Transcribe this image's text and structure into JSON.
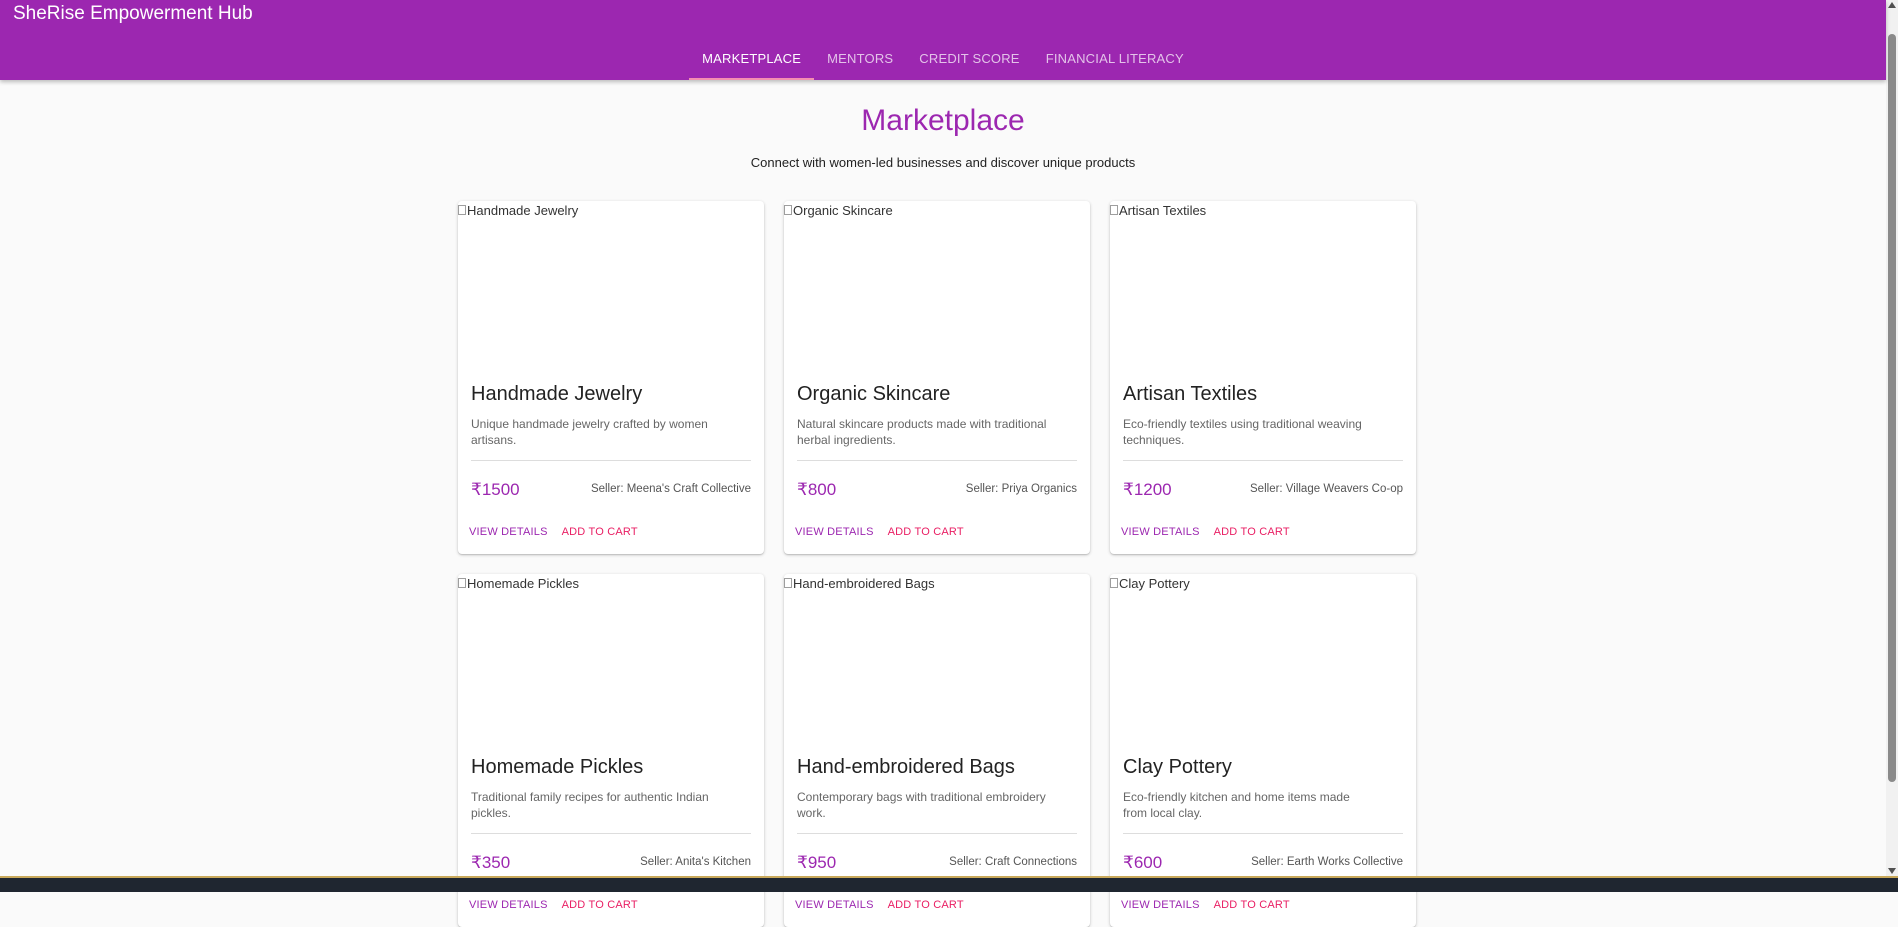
{
  "app": {
    "title": "SheRise Empowerment Hub"
  },
  "nav": {
    "tabs": [
      {
        "label": "MARKETPLACE",
        "active": true
      },
      {
        "label": "MENTORS",
        "active": false
      },
      {
        "label": "CREDIT SCORE",
        "active": false
      },
      {
        "label": "FINANCIAL LITERACY",
        "active": false
      }
    ]
  },
  "page": {
    "title": "Marketplace",
    "subtitle": "Connect with women-led businesses and discover unique products"
  },
  "products": [
    {
      "image_alt": "Handmade Jewelry",
      "name": "Handmade Jewelry",
      "description": "Unique handmade jewelry crafted by women artisans.",
      "price": "₹1500",
      "seller": "Seller: Meena's Craft Collective",
      "details_label": "VIEW DETAILS",
      "cart_label": "ADD TO CART"
    },
    {
      "image_alt": "Organic Skincare",
      "name": "Organic Skincare",
      "description": "Natural skincare products made with traditional herbal ingredients.",
      "price": "₹800",
      "seller": "Seller: Priya Organics",
      "details_label": "VIEW DETAILS",
      "cart_label": "ADD TO CART"
    },
    {
      "image_alt": "Artisan Textiles",
      "name": "Artisan Textiles",
      "description": "Eco-friendly textiles using traditional weaving techniques.",
      "price": "₹1200",
      "seller": "Seller: Village Weavers Co-op",
      "details_label": "VIEW DETAILS",
      "cart_label": "ADD TO CART"
    },
    {
      "image_alt": "Homemade Pickles",
      "name": "Homemade Pickles",
      "description": "Traditional family recipes for authentic Indian pickles.",
      "price": "₹350",
      "seller": "Seller: Anita's Kitchen",
      "details_label": "VIEW DETAILS",
      "cart_label": "ADD TO CART"
    },
    {
      "image_alt": "Hand-embroidered Bags",
      "name": "Hand-embroidered Bags",
      "description": "Contemporary bags with traditional embroidery work.",
      "price": "₹950",
      "seller": "Seller: Craft Connections",
      "details_label": "VIEW DETAILS",
      "cart_label": "ADD TO CART"
    },
    {
      "image_alt": "Clay Pottery",
      "name": "Clay Pottery",
      "description": "Eco-friendly kitchen and home items made from local clay.",
      "price": "₹600",
      "seller": "Seller: Earth Works Collective",
      "details_label": "VIEW DETAILS",
      "cart_label": "ADD TO CART"
    }
  ],
  "colors": {
    "primary": "#9c27b0",
    "accent": "#e91e63",
    "tab_indicator": "#f48fb1",
    "background": "#fafafa"
  }
}
